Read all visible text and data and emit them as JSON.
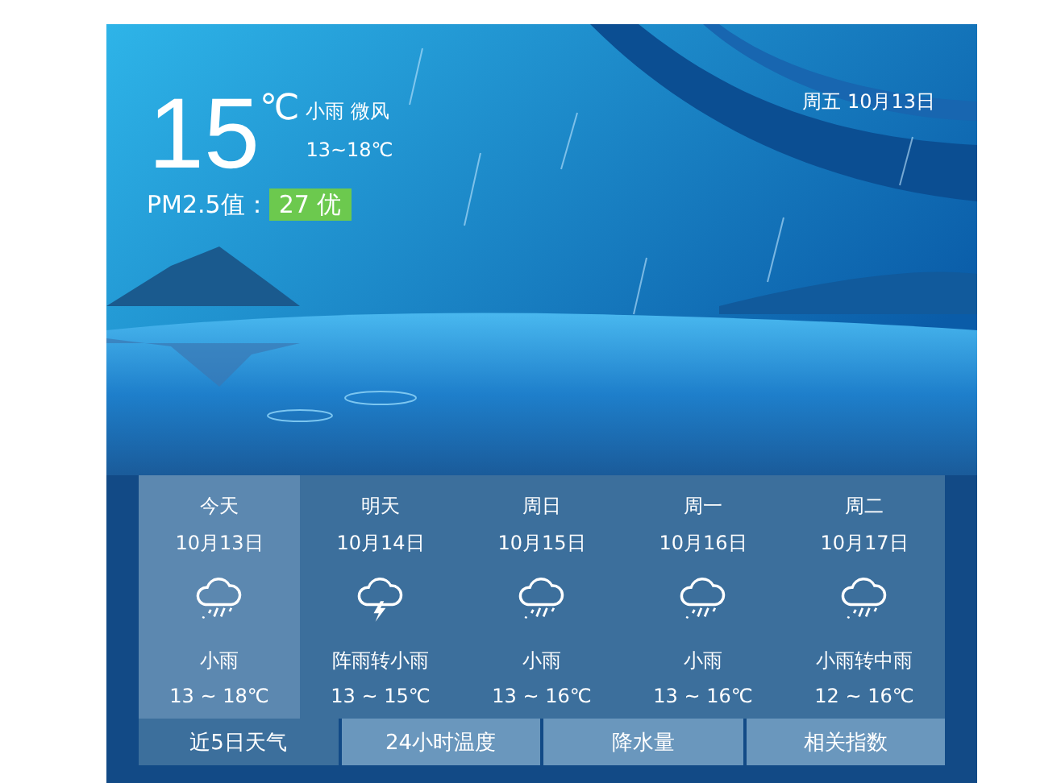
{
  "current": {
    "temperature": "15",
    "unit": "℃",
    "condition": "小雨 微风",
    "range": "13~18℃",
    "date": "周五 10月13日",
    "pm_label": "PM2.5值：",
    "pm_value": "27 优"
  },
  "forecast": [
    {
      "day": "今天",
      "date": "10月13日",
      "kind": "rain",
      "condition": "小雨",
      "range": "13 ~ 18℃",
      "selected": true
    },
    {
      "day": "明天",
      "date": "10月14日",
      "kind": "thunder",
      "condition": "阵雨转小雨",
      "range": "13 ~ 15℃",
      "selected": false
    },
    {
      "day": "周日",
      "date": "10月15日",
      "kind": "rain",
      "condition": "小雨",
      "range": "13 ~ 16℃",
      "selected": false
    },
    {
      "day": "周一",
      "date": "10月16日",
      "kind": "rain",
      "condition": "小雨",
      "range": "13 ~ 16℃",
      "selected": false
    },
    {
      "day": "周二",
      "date": "10月17日",
      "kind": "rain",
      "condition": "小雨转中雨",
      "range": "12 ~ 16℃",
      "selected": false
    }
  ],
  "tabs": [
    {
      "label": "近5日天气",
      "selected": true
    },
    {
      "label": "24小时温度",
      "selected": false
    },
    {
      "label": "降水量",
      "selected": false
    },
    {
      "label": "相关指数",
      "selected": false
    }
  ]
}
